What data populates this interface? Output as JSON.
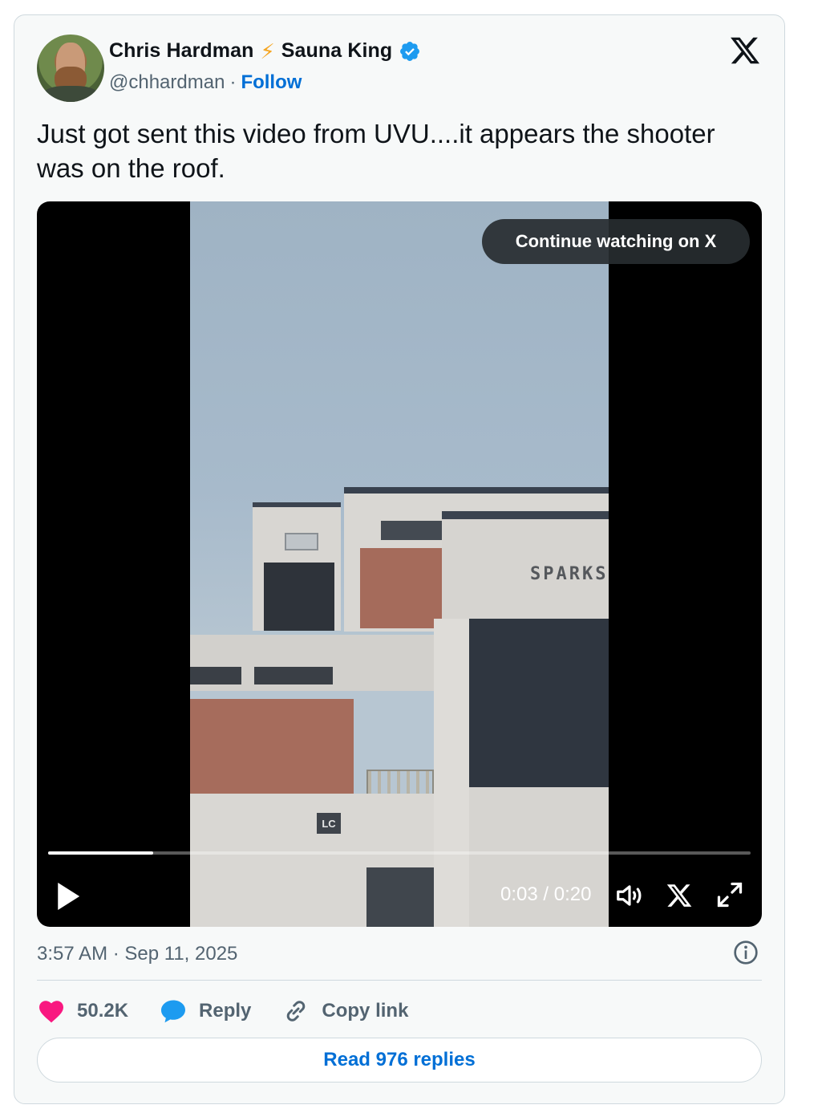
{
  "author": {
    "name_first": "Chris Hardman",
    "emoji": "⚡",
    "name_second": "Sauna King",
    "handle": "@chhardman",
    "separator": "·",
    "follow_label": "Follow",
    "verified": true
  },
  "tweet": {
    "text": "Just got sent this video from UVU....it appears the shooter was on the roof."
  },
  "video": {
    "continue_label": "Continue watching on X",
    "current_time": "0:03",
    "duration": "0:20",
    "time_label": "0:03 / 0:20",
    "progress": 0.15,
    "frame_signs": [
      "SPARKS",
      "LC"
    ]
  },
  "meta": {
    "timestamp": "3:57 AM · Sep 11, 2025"
  },
  "actions": {
    "likes": "50.2K",
    "reply_label": "Reply",
    "copy_label": "Copy link"
  },
  "read_replies_label": "Read 976 replies",
  "colors": {
    "link": "#006fd6",
    "verified": "#1d9bf0",
    "like": "#f91880",
    "muted": "#536471"
  }
}
